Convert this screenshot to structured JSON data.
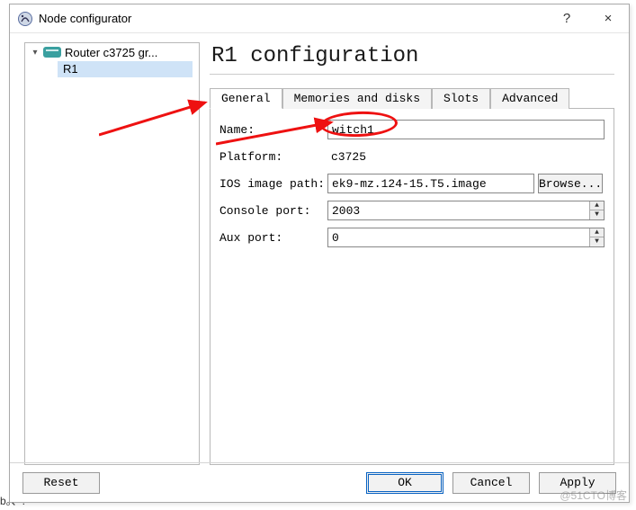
{
  "window": {
    "title": "Node configurator",
    "help_glyph": "?",
    "close_glyph": "×"
  },
  "tree": {
    "group_label": "Router c3725 gr...",
    "child_label": "R1"
  },
  "header": "R1 configuration",
  "tabs": [
    {
      "label": "General",
      "active": true
    },
    {
      "label": "Memories and disks",
      "active": false
    },
    {
      "label": "Slots",
      "active": false
    },
    {
      "label": "Advanced",
      "active": false
    }
  ],
  "form": {
    "name_label": "Name:",
    "name_value": "witch1",
    "platform_label": "Platform:",
    "platform_value": "c3725",
    "ios_label": "IOS image path:",
    "ios_value": "ek9-mz.124-15.T5.image",
    "browse_label": "Browse...",
    "console_label": "Console port:",
    "console_value": "2003",
    "aux_label": "Aux port:",
    "aux_value": "0"
  },
  "buttons": {
    "reset": "Reset",
    "ok": "OK",
    "cancel": "Cancel",
    "apply": "Apply"
  },
  "watermark": "@51CTO博客",
  "edge_fragment": "b。、."
}
